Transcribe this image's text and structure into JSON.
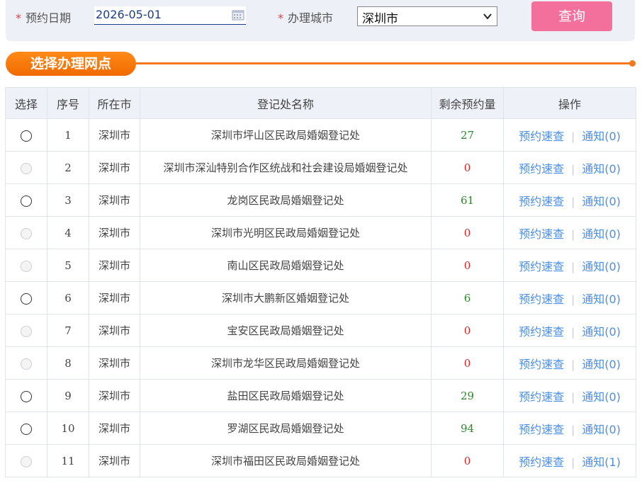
{
  "search": {
    "date_label": "预约日期",
    "date_value": "2026-05-01",
    "city_label": "办理城市",
    "city_value": "深圳市",
    "query_button": "查询",
    "required_mark": "*"
  },
  "section": {
    "title": "选择办理网点"
  },
  "table": {
    "headers": [
      "选择",
      "序号",
      "所在市",
      "登记处名称",
      "剩余预约量",
      "操作"
    ],
    "check_label": "预约速查",
    "separator": "|",
    "rows": [
      {
        "no": "1",
        "city": "深圳市",
        "name": "深圳市坪山区民政局婚姻登记处",
        "remain": "27",
        "notify": "通知(0)",
        "enabled": true
      },
      {
        "no": "2",
        "city": "深圳市",
        "name": "深圳市深汕特别合作区统战和社会建设局婚姻登记处",
        "remain": "0",
        "notify": "通知(0)",
        "enabled": false
      },
      {
        "no": "3",
        "city": "深圳市",
        "name": "龙岗区民政局婚姻登记处",
        "remain": "61",
        "notify": "通知(0)",
        "enabled": true
      },
      {
        "no": "4",
        "city": "深圳市",
        "name": "深圳市光明区民政局婚姻登记处",
        "remain": "0",
        "notify": "通知(0)",
        "enabled": false
      },
      {
        "no": "5",
        "city": "深圳市",
        "name": "南山区民政局婚姻登记处",
        "remain": "0",
        "notify": "通知(0)",
        "enabled": false
      },
      {
        "no": "6",
        "city": "深圳市",
        "name": "深圳市大鹏新区婚姻登记处",
        "remain": "6",
        "notify": "通知(0)",
        "enabled": true
      },
      {
        "no": "7",
        "city": "深圳市",
        "name": "宝安区民政局婚姻登记处",
        "remain": "0",
        "notify": "通知(0)",
        "enabled": false
      },
      {
        "no": "8",
        "city": "深圳市",
        "name": "深圳市龙华区民政局婚姻登记处",
        "remain": "0",
        "notify": "通知(0)",
        "enabled": false
      },
      {
        "no": "9",
        "city": "深圳市",
        "name": "盐田区民政局婚姻登记处",
        "remain": "29",
        "notify": "通知(0)",
        "enabled": true
      },
      {
        "no": "10",
        "city": "深圳市",
        "name": "罗湖区民政局婚姻登记处",
        "remain": "94",
        "notify": "通知(0)",
        "enabled": true
      },
      {
        "no": "11",
        "city": "深圳市",
        "name": "深圳市福田区民政局婚姻登记处",
        "remain": "0",
        "notify": "通知(1)",
        "enabled": false
      }
    ]
  },
  "colors": {
    "accent_orange": "#f5781f",
    "query_pink": "#f2709b",
    "link_blue": "#4a8ee8",
    "positive_green": "#2a8a2a",
    "zero_red": "#e02020"
  },
  "icons": {
    "date": "calendar-icon",
    "city": "chevron-down-icon"
  }
}
